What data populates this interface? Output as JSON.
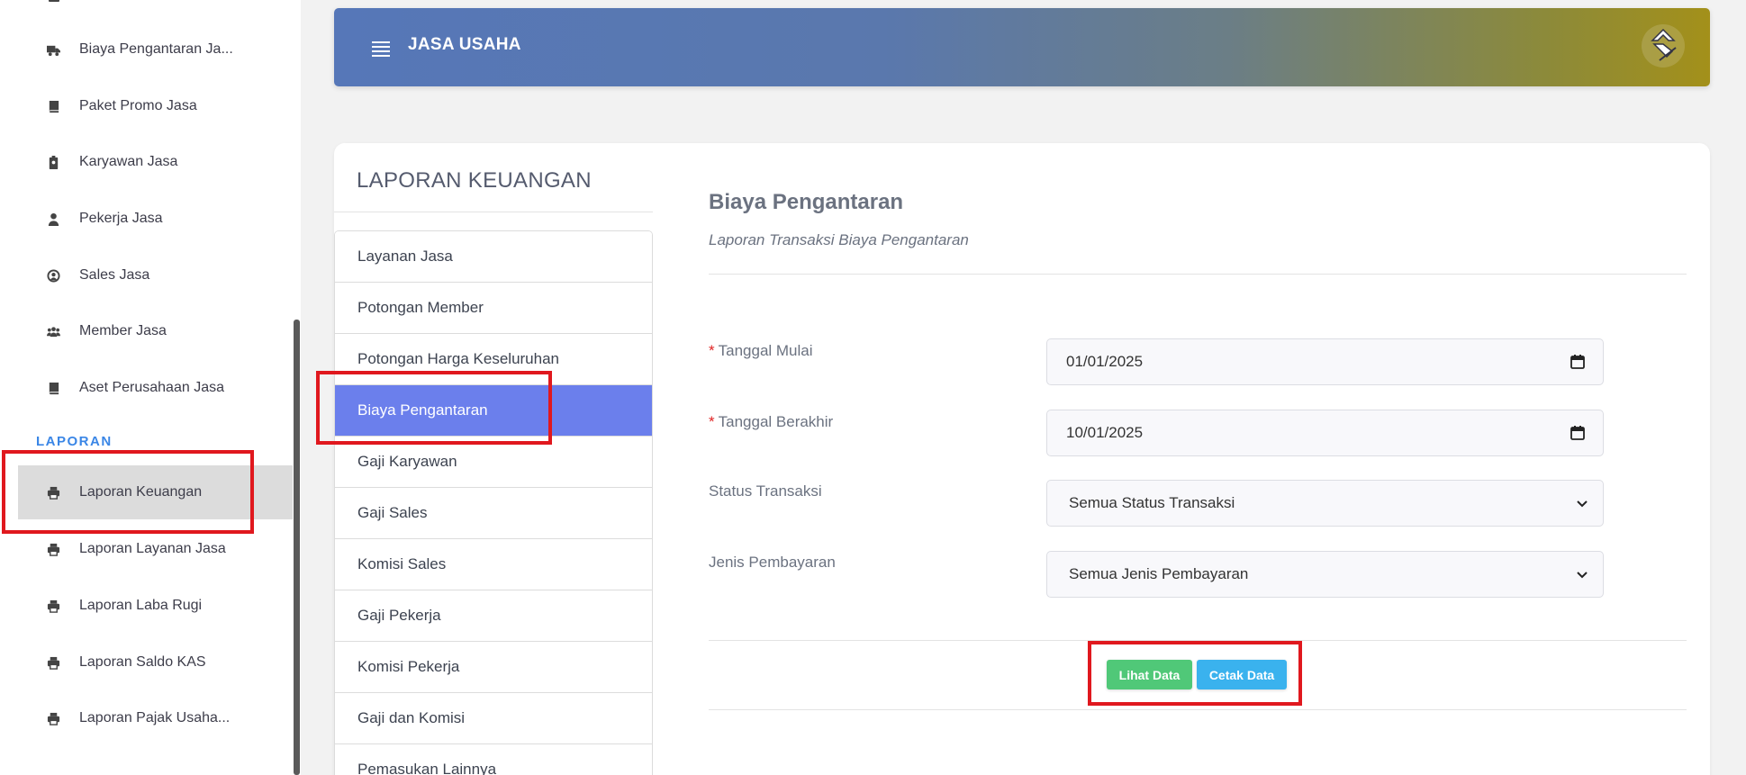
{
  "sidebar": {
    "items": [
      {
        "label": "Biaya Pengantaran Ja...",
        "icon": "truck-icon"
      },
      {
        "label": "Paket Promo Jasa",
        "icon": "book-icon"
      },
      {
        "label": "Karyawan Jasa",
        "icon": "id-badge-icon"
      },
      {
        "label": "Pekerja Jasa",
        "icon": "user-icon"
      },
      {
        "label": "Sales Jasa",
        "icon": "user-circle-icon"
      },
      {
        "label": "Member Jasa",
        "icon": "users-icon"
      },
      {
        "label": "Aset Perusahaan Jasa",
        "icon": "book-icon"
      }
    ],
    "section_label": "LAPORAN",
    "report_items": [
      {
        "label": "Laporan Keuangan",
        "icon": "printer-icon",
        "active": true
      },
      {
        "label": "Laporan Layanan Jasa",
        "icon": "printer-icon"
      },
      {
        "label": "Laporan Laba Rugi",
        "icon": "printer-icon"
      },
      {
        "label": "Laporan Saldo KAS",
        "icon": "printer-icon"
      },
      {
        "label": "Laporan Pajak Usaha...",
        "icon": "printer-icon"
      }
    ]
  },
  "header": {
    "title": "JASA USAHA"
  },
  "card": {
    "title": "LAPORAN KEUANGAN",
    "reports": [
      "Layanan Jasa",
      "Potongan Member",
      "Potongan Harga Keseluruhan",
      "Biaya Pengantaran",
      "Gaji Karyawan",
      "Gaji Sales",
      "Komisi Sales",
      "Gaji Pekerja",
      "Komisi Pekerja",
      "Gaji dan Komisi",
      "Pemasukan Lainnya"
    ],
    "active_report": "Biaya Pengantaran"
  },
  "panel": {
    "title": "Biaya Pengantaran",
    "subtitle": "Laporan Transaksi Biaya Pengantaran",
    "fields": {
      "start_date": {
        "label": "Tanggal Mulai",
        "required_mark": "*",
        "value": "01/01/2025"
      },
      "end_date": {
        "label": "Tanggal Berakhir",
        "required_mark": "*",
        "value": "10/01/2025"
      },
      "status": {
        "label": "Status Transaksi",
        "value": "Semua Status Transaksi"
      },
      "payment": {
        "label": "Jenis Pembayaran",
        "value": "Semua Jenis Pembayaran"
      }
    },
    "buttons": {
      "view": "Lihat Data",
      "print": "Cetak Data"
    }
  },
  "colors": {
    "accent_active": "#6b7fec",
    "section_label": "#3a86e6",
    "button_view": "#50c878",
    "button_print": "#3ab2ee",
    "annotation": "#e0181e"
  }
}
